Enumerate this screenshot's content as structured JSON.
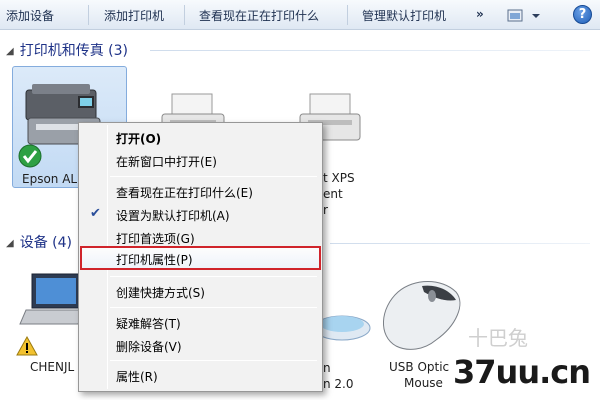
{
  "toolbar": {
    "add_device": "添加设备",
    "add_printer": "添加打印机",
    "see_printing": "查看现在正在打印什么",
    "manage_default": "管理默认打印机",
    "more": "»",
    "help": "?"
  },
  "groups": {
    "printers": {
      "title": "打印机和传真 (3)"
    },
    "devices": {
      "title": "设备 (4)"
    }
  },
  "printers": [
    {
      "label": "Epson AL",
      "status": "default"
    },
    {
      "label": ""
    },
    {
      "label_lines": [
        "t XPS",
        "ent",
        "r"
      ]
    }
  ],
  "devices": [
    {
      "label": "CHENJL"
    },
    {
      "label_lines": [
        "n",
        "n 2.0"
      ]
    },
    {
      "label_lines": [
        "USB Optic",
        "Mouse"
      ]
    }
  ],
  "context_menu": {
    "items": [
      {
        "label": "打开(O)",
        "bold": true
      },
      {
        "label": "在新窗口中打开(E)"
      },
      {
        "label": "查看现在正在打印什么(E)"
      },
      {
        "label": "设置为默认打印机(A)",
        "checked": true
      },
      {
        "label": "打印首选项(G)"
      },
      {
        "label": "打印机属性(P)",
        "highlighted": true
      },
      {
        "label": "创建快捷方式(S)"
      },
      {
        "label": "疑难解答(T)"
      },
      {
        "label": "删除设备(V)"
      },
      {
        "label": "属性(R)"
      }
    ]
  },
  "watermark": {
    "text": "37uu.cn",
    "faint": "十巴兔"
  },
  "colors": {
    "highlight_border": "#d0242b",
    "header_text": "#1e3287",
    "check": "#2a4e9a"
  }
}
